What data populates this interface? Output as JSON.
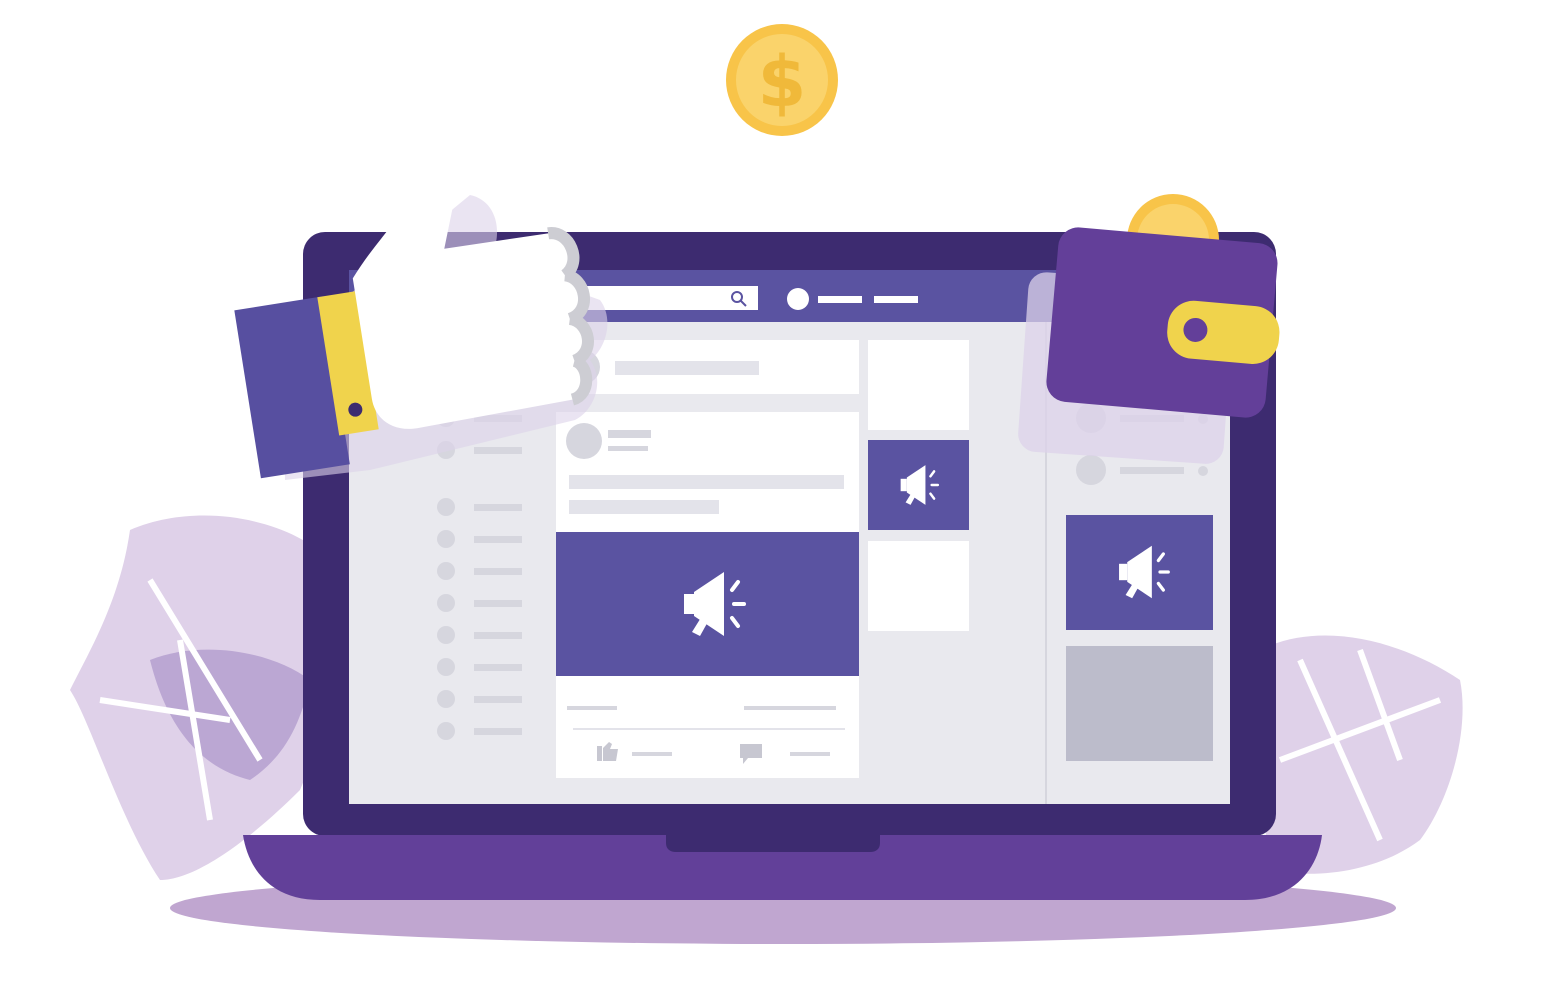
{
  "illustration": {
    "theme": "social-media-paid-advertising",
    "colors": {
      "background": "#ffffff",
      "laptop_frame": "#3d2b70",
      "laptop_base": "#624099",
      "laptop_shadow": "#c0a6d0",
      "screen_bg": "#e9e9ee",
      "accent": "#5a53a1",
      "card": "#ffffff",
      "placeholder": "#d6d6de",
      "placeholder_dark": "#c7c7d1",
      "gray_block": "#bcbccb",
      "leaf": "#dfd1e9",
      "leaf_dark": "#bba7d3",
      "coin_outer": "#f8c449",
      "coin_inner": "#fad36b",
      "wallet": "#633f99",
      "wallet_strap": "#f0d34c",
      "sleeve": "#574fa0",
      "cuff": "#f0d34c",
      "hand": "#ffffff",
      "hand_shade": "#cdcdd3"
    },
    "coin": {
      "symbol": "$"
    },
    "feed": {
      "post_count": 2,
      "sidebar_item_count": 10,
      "right_column_item_count": 4
    },
    "icons": {
      "ad": "megaphone-icon",
      "search": "search-icon",
      "like": "thumbs-up-icon",
      "comment": "comment-icon"
    }
  }
}
